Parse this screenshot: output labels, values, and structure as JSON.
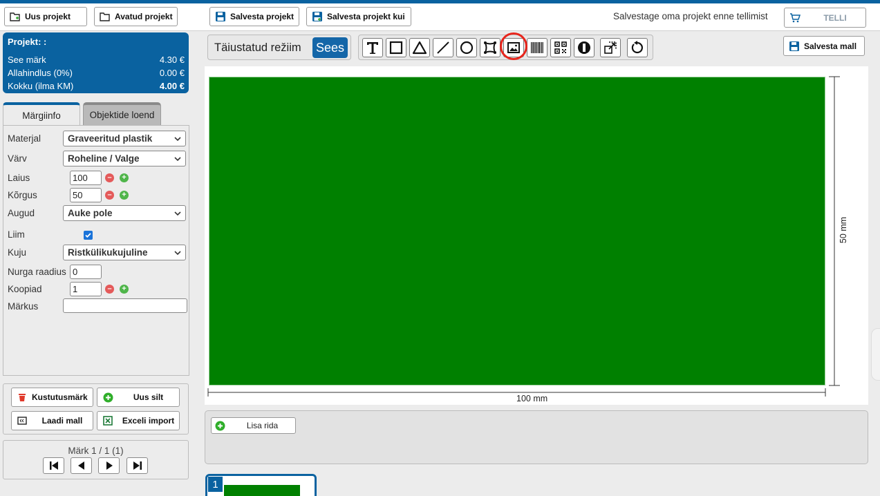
{
  "topbar": {
    "new_project": "Uus projekt",
    "open_project": "Avatud projekt",
    "save_project": "Salvesta projekt",
    "save_project_as": "Salvesta projekt kui",
    "message": "Salvestage oma projekt enne tellimist",
    "order": "TELLI"
  },
  "project": {
    "title": "Projekt: :",
    "rows": [
      {
        "label": "See märk",
        "value": "4.30 €"
      },
      {
        "label": "Allahindlus (0%)",
        "value": "0.00 €"
      },
      {
        "label": "Kokku (ilma KM)",
        "value": "4.00 €"
      }
    ]
  },
  "tabs": {
    "info": "Märgiinfo",
    "objects": "Objektide loend"
  },
  "fields": {
    "material_label": "Materjal",
    "material_value": "Graveeritud plastik",
    "color_label": "Värv",
    "color_value": "Roheline / Valge",
    "width_label": "Laius",
    "width_value": "100",
    "height_label": "Kõrgus",
    "height_value": "50",
    "holes_label": "Augud",
    "holes_value": "Auke pole",
    "glue_label": "Liim",
    "glue_checked": true,
    "shape_label": "Kuju",
    "shape_value": "Ristkülikukujuline",
    "corner_label": "Nurga raadius",
    "corner_value": "0",
    "copies_label": "Koopiad",
    "copies_value": "1",
    "note_label": "Märkus",
    "note_value": ""
  },
  "actions": {
    "delete_sign": "Kustutusmärk",
    "new_label": "Uus silt",
    "load_template": "Laadi mall",
    "excel_import": "Exceli import"
  },
  "nav": {
    "counter": "Märk 1 / 1 (1)"
  },
  "toolbar": {
    "mode_label": "Täiustatud režiim",
    "mode_value": "Sees",
    "save_template": "Salvesta mall"
  },
  "canvas": {
    "width_dim": "100 mm",
    "height_dim": "50 mm",
    "label_color": "#008000"
  },
  "rows": {
    "add_row": "Lisa rida"
  },
  "thumbs": [
    {
      "number": "1"
    }
  ],
  "colors": {
    "accent": "#0a62a0",
    "danger": "#e45a5a",
    "success": "#4fb54a",
    "highlight": "#e8251c"
  }
}
